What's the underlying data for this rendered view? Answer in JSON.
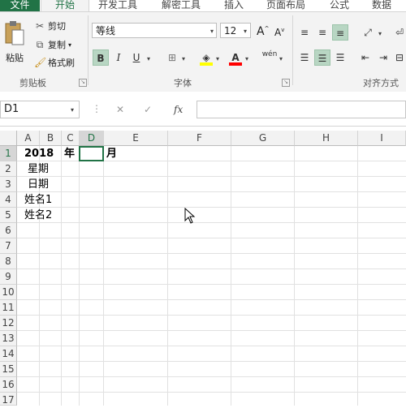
{
  "ribbon_tabs": [
    "文件",
    "开始",
    "开发工具",
    "解密工具",
    "插入",
    "页面布局",
    "公式",
    "数据"
  ],
  "clipboard": {
    "paste": "粘贴",
    "cut": "剪切",
    "copy": "复制",
    "format_painter": "格式刷",
    "group_label": "剪贴板"
  },
  "font": {
    "name": "等线",
    "size": "12",
    "bold": "B",
    "italic": "I",
    "underline": "U",
    "phonetic": "wén",
    "group_label": "字体"
  },
  "alignment": {
    "group_label": "对齐方式"
  },
  "formula_bar": {
    "name_box": "D1",
    "fx": "fx",
    "value": ""
  },
  "columns": [
    "A",
    "B",
    "C",
    "D",
    "E",
    "F",
    "G",
    "H",
    "I"
  ],
  "rows": [
    "1",
    "2",
    "3",
    "4",
    "5",
    "6",
    "7",
    "8",
    "9",
    "10",
    "11",
    "12",
    "13",
    "14",
    "15",
    "16",
    "17"
  ],
  "cells": {
    "A1": "2018",
    "C1": "年",
    "E1": "月",
    "A2": "星期",
    "A3": "日期",
    "A4": "姓名1",
    "A5": "姓名2"
  },
  "colors": {
    "brand": "#217346",
    "active_toggle": "#b8d6c3",
    "highlight": "#ffff00",
    "font_color": "#ff0000"
  }
}
